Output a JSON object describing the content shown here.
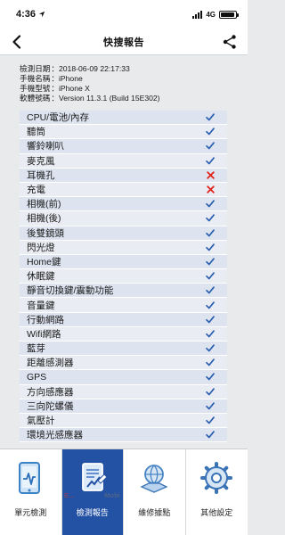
{
  "status_bar": {
    "time": "4:36",
    "network": "4G",
    "battery_level": 0.95,
    "icons": [
      "location-arrow-icon",
      "signal-icon",
      "battery-icon"
    ]
  },
  "nav": {
    "title": "快搜報告",
    "back_icon": "chevron-left-icon",
    "share_icon": "share-icon"
  },
  "info": [
    {
      "label": "檢測日期",
      "value": "2018-06-09 22:17:33"
    },
    {
      "label": "手機名稱",
      "value": "iPhone"
    },
    {
      "label": "手機型號",
      "value": "iPhone X"
    },
    {
      "label": "軟體號碼",
      "value": "Version 11.3.1 (Build 15E302)"
    }
  ],
  "checks": [
    {
      "label": "CPU/電池/內存",
      "status": "pass"
    },
    {
      "label": "聽筒",
      "status": "pass"
    },
    {
      "label": "響鈴喇叭",
      "status": "pass"
    },
    {
      "label": "麥克風",
      "status": "pass"
    },
    {
      "label": "耳機孔",
      "status": "fail"
    },
    {
      "label": "充電",
      "status": "fail"
    },
    {
      "label": "相機(前)",
      "status": "pass"
    },
    {
      "label": "相機(後)",
      "status": "pass"
    },
    {
      "label": "後雙鏡頭",
      "status": "pass"
    },
    {
      "label": "閃光燈",
      "status": "pass"
    },
    {
      "label": "Home鍵",
      "status": "pass"
    },
    {
      "label": "休眠鍵",
      "status": "pass"
    },
    {
      "label": "靜音切換鍵/震動功能",
      "status": "pass"
    },
    {
      "label": "音量鍵",
      "status": "pass"
    },
    {
      "label": "行動網路",
      "status": "pass"
    },
    {
      "label": "Wifi網路",
      "status": "pass"
    },
    {
      "label": "藍芽",
      "status": "pass"
    },
    {
      "label": "距離感測器",
      "status": "pass"
    },
    {
      "label": "GPS",
      "status": "pass"
    },
    {
      "label": "方向感應器",
      "status": "pass"
    },
    {
      "label": "三向陀螺儀",
      "status": "pass"
    },
    {
      "label": "氣壓計",
      "status": "pass"
    },
    {
      "label": "環境光感應器",
      "status": "pass"
    }
  ],
  "status_colors": {
    "pass": "#2a5db0",
    "fail": "#e0231b"
  },
  "status_icons": {
    "pass": "checkmark-icon",
    "fail": "cross-icon"
  },
  "tabs": [
    {
      "label": "單元檢測",
      "icon": "phone-diagnostic-icon",
      "active": false
    },
    {
      "label": "檢測報告",
      "icon": "report-document-icon",
      "active": true
    },
    {
      "label": "維修據點",
      "icon": "location-globe-icon",
      "active": false
    },
    {
      "label": "其他設定",
      "icon": "gear-icon",
      "active": false
    }
  ],
  "watermark": {
    "left": "E...",
    "right": "Mobi"
  },
  "colors": {
    "accent": "#2351a3",
    "background": "#e9eaec"
  }
}
